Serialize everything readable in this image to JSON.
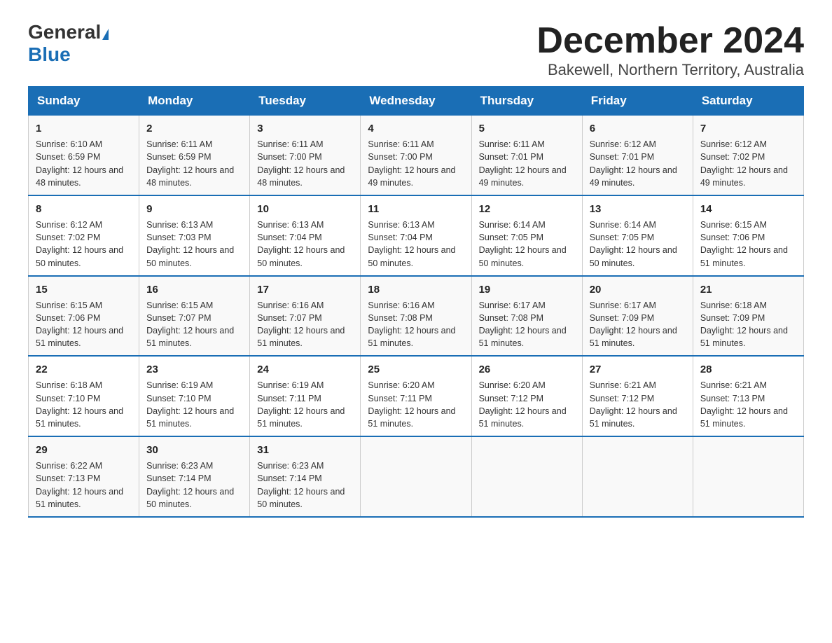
{
  "logo": {
    "general": "General",
    "blue": "Blue"
  },
  "title": "December 2024",
  "subtitle": "Bakewell, Northern Territory, Australia",
  "days_of_week": [
    "Sunday",
    "Monday",
    "Tuesday",
    "Wednesday",
    "Thursday",
    "Friday",
    "Saturday"
  ],
  "weeks": [
    [
      {
        "day": "1",
        "sunrise": "6:10 AM",
        "sunset": "6:59 PM",
        "daylight": "12 hours and 48 minutes."
      },
      {
        "day": "2",
        "sunrise": "6:11 AM",
        "sunset": "6:59 PM",
        "daylight": "12 hours and 48 minutes."
      },
      {
        "day": "3",
        "sunrise": "6:11 AM",
        "sunset": "7:00 PM",
        "daylight": "12 hours and 48 minutes."
      },
      {
        "day": "4",
        "sunrise": "6:11 AM",
        "sunset": "7:00 PM",
        "daylight": "12 hours and 49 minutes."
      },
      {
        "day": "5",
        "sunrise": "6:11 AM",
        "sunset": "7:01 PM",
        "daylight": "12 hours and 49 minutes."
      },
      {
        "day": "6",
        "sunrise": "6:12 AM",
        "sunset": "7:01 PM",
        "daylight": "12 hours and 49 minutes."
      },
      {
        "day": "7",
        "sunrise": "6:12 AM",
        "sunset": "7:02 PM",
        "daylight": "12 hours and 49 minutes."
      }
    ],
    [
      {
        "day": "8",
        "sunrise": "6:12 AM",
        "sunset": "7:02 PM",
        "daylight": "12 hours and 50 minutes."
      },
      {
        "day": "9",
        "sunrise": "6:13 AM",
        "sunset": "7:03 PM",
        "daylight": "12 hours and 50 minutes."
      },
      {
        "day": "10",
        "sunrise": "6:13 AM",
        "sunset": "7:04 PM",
        "daylight": "12 hours and 50 minutes."
      },
      {
        "day": "11",
        "sunrise": "6:13 AM",
        "sunset": "7:04 PM",
        "daylight": "12 hours and 50 minutes."
      },
      {
        "day": "12",
        "sunrise": "6:14 AM",
        "sunset": "7:05 PM",
        "daylight": "12 hours and 50 minutes."
      },
      {
        "day": "13",
        "sunrise": "6:14 AM",
        "sunset": "7:05 PM",
        "daylight": "12 hours and 50 minutes."
      },
      {
        "day": "14",
        "sunrise": "6:15 AM",
        "sunset": "7:06 PM",
        "daylight": "12 hours and 51 minutes."
      }
    ],
    [
      {
        "day": "15",
        "sunrise": "6:15 AM",
        "sunset": "7:06 PM",
        "daylight": "12 hours and 51 minutes."
      },
      {
        "day": "16",
        "sunrise": "6:15 AM",
        "sunset": "7:07 PM",
        "daylight": "12 hours and 51 minutes."
      },
      {
        "day": "17",
        "sunrise": "6:16 AM",
        "sunset": "7:07 PM",
        "daylight": "12 hours and 51 minutes."
      },
      {
        "day": "18",
        "sunrise": "6:16 AM",
        "sunset": "7:08 PM",
        "daylight": "12 hours and 51 minutes."
      },
      {
        "day": "19",
        "sunrise": "6:17 AM",
        "sunset": "7:08 PM",
        "daylight": "12 hours and 51 minutes."
      },
      {
        "day": "20",
        "sunrise": "6:17 AM",
        "sunset": "7:09 PM",
        "daylight": "12 hours and 51 minutes."
      },
      {
        "day": "21",
        "sunrise": "6:18 AM",
        "sunset": "7:09 PM",
        "daylight": "12 hours and 51 minutes."
      }
    ],
    [
      {
        "day": "22",
        "sunrise": "6:18 AM",
        "sunset": "7:10 PM",
        "daylight": "12 hours and 51 minutes."
      },
      {
        "day": "23",
        "sunrise": "6:19 AM",
        "sunset": "7:10 PM",
        "daylight": "12 hours and 51 minutes."
      },
      {
        "day": "24",
        "sunrise": "6:19 AM",
        "sunset": "7:11 PM",
        "daylight": "12 hours and 51 minutes."
      },
      {
        "day": "25",
        "sunrise": "6:20 AM",
        "sunset": "7:11 PM",
        "daylight": "12 hours and 51 minutes."
      },
      {
        "day": "26",
        "sunrise": "6:20 AM",
        "sunset": "7:12 PM",
        "daylight": "12 hours and 51 minutes."
      },
      {
        "day": "27",
        "sunrise": "6:21 AM",
        "sunset": "7:12 PM",
        "daylight": "12 hours and 51 minutes."
      },
      {
        "day": "28",
        "sunrise": "6:21 AM",
        "sunset": "7:13 PM",
        "daylight": "12 hours and 51 minutes."
      }
    ],
    [
      {
        "day": "29",
        "sunrise": "6:22 AM",
        "sunset": "7:13 PM",
        "daylight": "12 hours and 51 minutes."
      },
      {
        "day": "30",
        "sunrise": "6:23 AM",
        "sunset": "7:14 PM",
        "daylight": "12 hours and 50 minutes."
      },
      {
        "day": "31",
        "sunrise": "6:23 AM",
        "sunset": "7:14 PM",
        "daylight": "12 hours and 50 minutes."
      },
      null,
      null,
      null,
      null
    ]
  ]
}
